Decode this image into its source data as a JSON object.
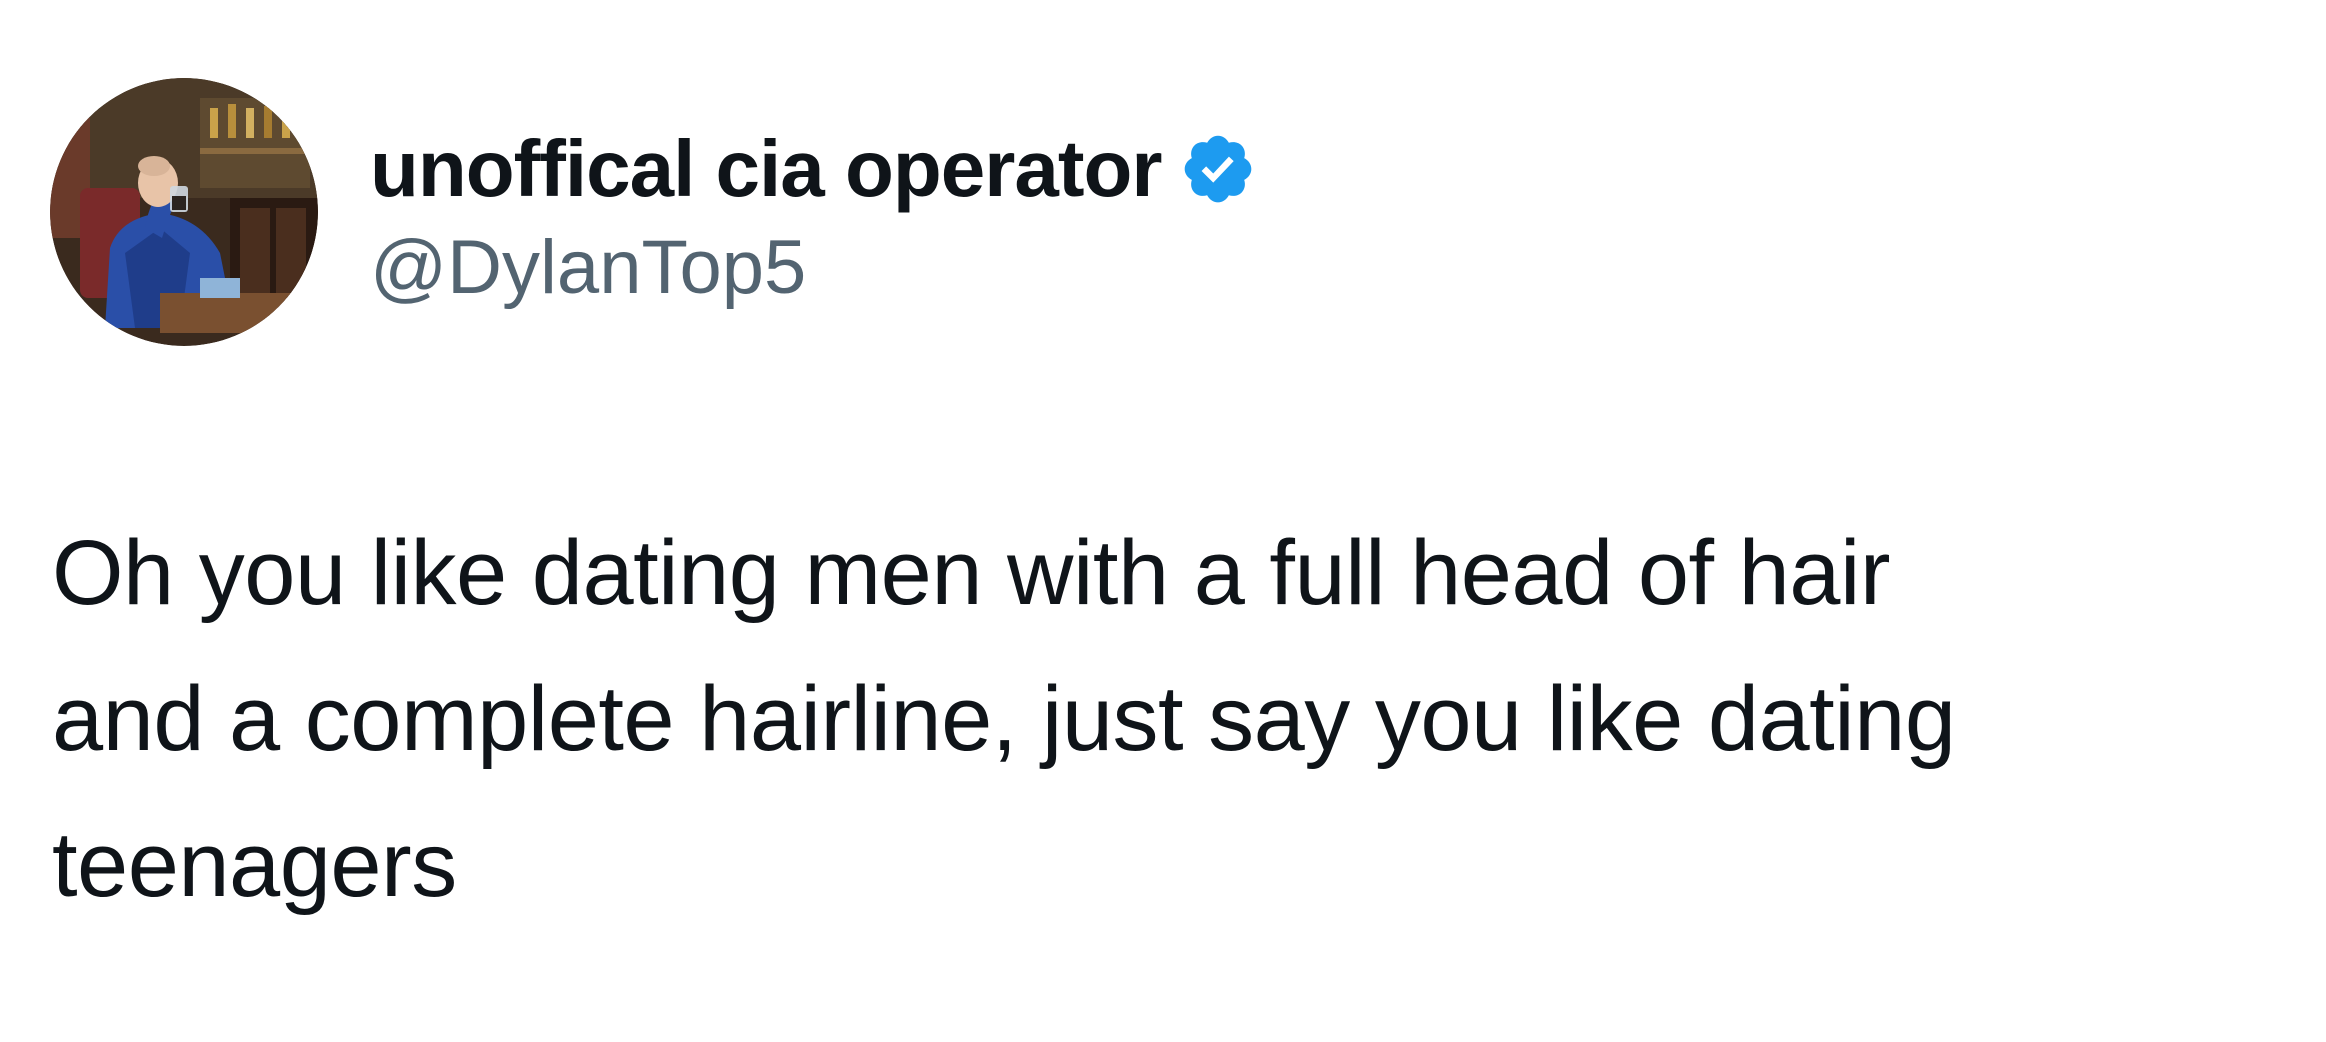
{
  "tweet": {
    "author": {
      "display_name": "unoffical cia operator",
      "handle": "@DylanTop5",
      "verified": true,
      "verified_badge_color": "#1d9bf0",
      "avatar_icon": "profile-photo"
    },
    "text": "Oh you like dating men with a full head of hair\nand a complete hairline, just say you like dating\nteenagers"
  },
  "colors": {
    "background": "#ffffff",
    "primary_text": "#0f1419",
    "secondary_text": "#536471"
  }
}
